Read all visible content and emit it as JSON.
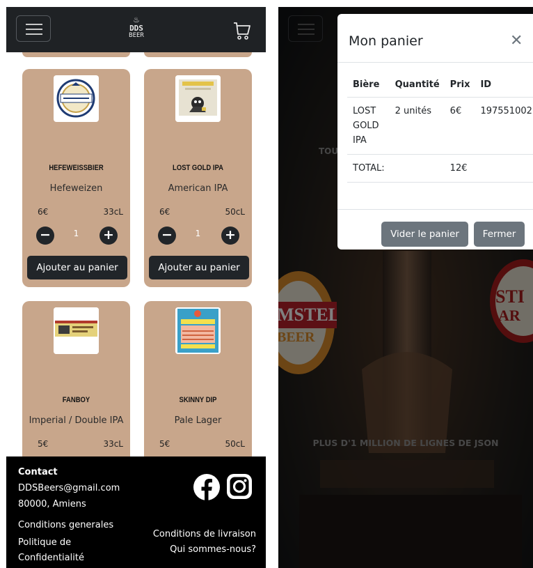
{
  "left_screen": {
    "navbar": {
      "logo_line1": "DDS",
      "logo_line2": "BEER"
    },
    "products": [
      {
        "name": "HEFEWEISSBIER",
        "style": "Hefeweizen",
        "price": "6€",
        "volume": "33cL",
        "quantity": "1",
        "add_label": "Ajouter au panier",
        "minus": "−",
        "plus": "+"
      },
      {
        "name": "LOST GOLD IPA",
        "style": "American IPA",
        "price": "6€",
        "volume": "50cL",
        "quantity": "1",
        "add_label": "Ajouter au panier",
        "minus": "−",
        "plus": "+"
      },
      {
        "name": "FANBOY",
        "style": "Imperial / Double IPA",
        "price": "5€",
        "volume": "33cL"
      },
      {
        "name": "SKINNY DIP",
        "style": "Pale Lager",
        "price": "5€",
        "volume": "50cL"
      }
    ],
    "footer": {
      "contact_title": "Contact",
      "email": "DDSBeers@gmail.com",
      "city": "80000, Amiens",
      "terms": "Conditions generales",
      "privacy": "Politique de Confidentialité",
      "delivery": "Conditions de livraison",
      "about": "Qui sommes-nous?"
    }
  },
  "right_screen": {
    "background": {
      "text_partial": "TOU",
      "tagline": "PLUS D'1 MILLION DE LIGNES DE JSON",
      "sign_left_line1": "MSTEL",
      "sign_left_line2": "BEER",
      "sign_right_line1": "STI",
      "sign_right_line2": "AR"
    },
    "modal": {
      "title": "Mon panier",
      "close": "✕",
      "columns": [
        "Bière",
        "Quantité",
        "Prix",
        "ID"
      ],
      "rows": [
        {
          "beer": "LOST GOLD IPA",
          "quantity": "2 unités",
          "price": "6€",
          "id": "197551002"
        }
      ],
      "total_label": "TOTAL:",
      "total_value": "12€",
      "empty_button": "Vider le panier",
      "close_button": "Fermer"
    }
  }
}
